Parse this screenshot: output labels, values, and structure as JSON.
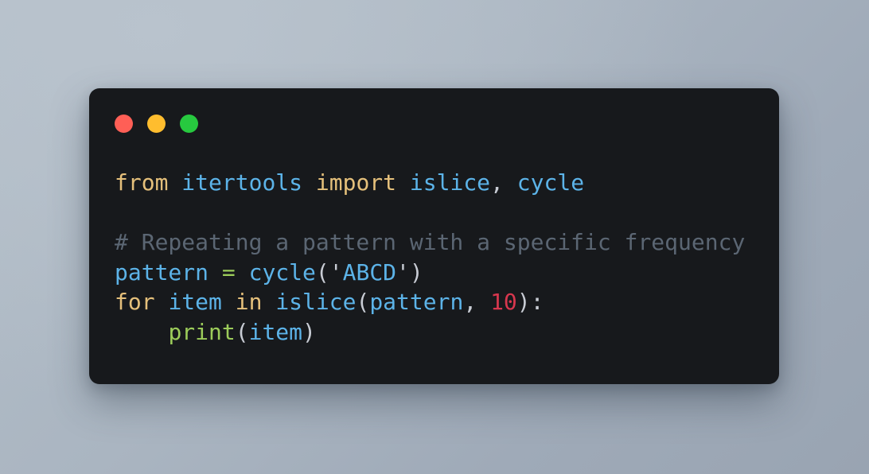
{
  "background": {
    "color_top_left": "#b4bfc9",
    "color_bottom_right": "#99a4b2"
  },
  "card": {
    "background_color": "#17191c",
    "corner_radius_px": 13
  },
  "window_controls": [
    {
      "name": "close",
      "color": "#ff5f56"
    },
    {
      "name": "minimize",
      "color": "#ffbd2e"
    },
    {
      "name": "maximize",
      "color": "#27c93f"
    }
  ],
  "code": {
    "language": "python",
    "plain_text": "from itertools import islice, cycle\n\n# Repeating a pattern with a specific frequency\npattern = cycle('ABCD')\nfor item in islice(pattern, 10):\n    print(item)",
    "lines": [
      {
        "index": 1,
        "text": "from itertools import islice, cycle",
        "tokens": [
          {
            "t": "from",
            "c": "kw"
          },
          {
            "t": " ",
            "c": "punct"
          },
          {
            "t": "itertools",
            "c": "ident"
          },
          {
            "t": " ",
            "c": "punct"
          },
          {
            "t": "import",
            "c": "kw"
          },
          {
            "t": " ",
            "c": "punct"
          },
          {
            "t": "islice",
            "c": "ident"
          },
          {
            "t": ",",
            "c": "punct"
          },
          {
            "t": " ",
            "c": "punct"
          },
          {
            "t": "cycle",
            "c": "ident"
          }
        ]
      },
      {
        "index": 2,
        "text": "",
        "tokens": []
      },
      {
        "index": 3,
        "text": "# Repeating a pattern with a specific frequency",
        "tokens": [
          {
            "t": "# Repeating a pattern with a specific frequency",
            "c": "comment"
          }
        ]
      },
      {
        "index": 4,
        "text": "pattern = cycle('ABCD')",
        "tokens": [
          {
            "t": "pattern",
            "c": "ident"
          },
          {
            "t": " ",
            "c": "punct"
          },
          {
            "t": "=",
            "c": "op"
          },
          {
            "t": " ",
            "c": "punct"
          },
          {
            "t": "cycle",
            "c": "ident"
          },
          {
            "t": "(",
            "c": "punct"
          },
          {
            "t": "'",
            "c": "punct"
          },
          {
            "t": "ABCD",
            "c": "str"
          },
          {
            "t": "'",
            "c": "punct"
          },
          {
            "t": ")",
            "c": "punct"
          }
        ]
      },
      {
        "index": 5,
        "text": "for item in islice(pattern, 10):",
        "tokens": [
          {
            "t": "for",
            "c": "kw"
          },
          {
            "t": " ",
            "c": "punct"
          },
          {
            "t": "item",
            "c": "ident"
          },
          {
            "t": " ",
            "c": "punct"
          },
          {
            "t": "in",
            "c": "kw"
          },
          {
            "t": " ",
            "c": "punct"
          },
          {
            "t": "islice",
            "c": "ident"
          },
          {
            "t": "(",
            "c": "punct"
          },
          {
            "t": "pattern",
            "c": "ident"
          },
          {
            "t": ",",
            "c": "punct"
          },
          {
            "t": " ",
            "c": "punct"
          },
          {
            "t": "10",
            "c": "num"
          },
          {
            "t": ")",
            "c": "punct"
          },
          {
            "t": ":",
            "c": "punct"
          }
        ]
      },
      {
        "index": 6,
        "text": "    print(item)",
        "tokens": [
          {
            "t": "    ",
            "c": "punct"
          },
          {
            "t": "print",
            "c": "func"
          },
          {
            "t": "(",
            "c": "punct"
          },
          {
            "t": "item",
            "c": "ident"
          },
          {
            "t": ")",
            "c": "punct"
          }
        ]
      }
    ]
  },
  "syntax_colors": {
    "keyword": "#e5c07b",
    "identifier": "#5cb3e8",
    "punctuation": "#c8ccd4",
    "comment": "#5b6673",
    "operator": "#9ccc5a",
    "function": "#9ccc5a",
    "string": "#5cb3e8",
    "number": "#d8374e"
  }
}
